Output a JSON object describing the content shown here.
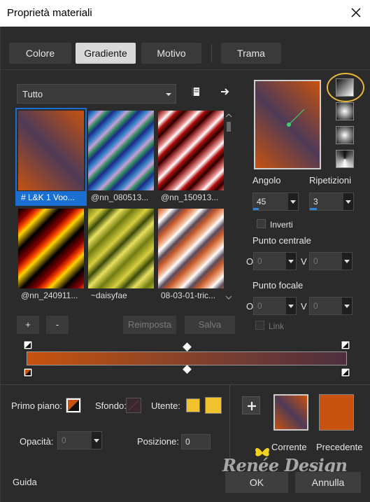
{
  "window": {
    "title": "Proprietà materiali"
  },
  "tabs": [
    {
      "label": "Colore"
    },
    {
      "label": "Gradiente"
    },
    {
      "label": "Motivo"
    },
    {
      "label": "Trama"
    }
  ],
  "gallery": {
    "filter": "Tutto",
    "items": [
      {
        "label": "# L&K 1 Voo..."
      },
      {
        "label": "@nn_080513..."
      },
      {
        "label": "@nn_150913..."
      },
      {
        "label": "@nn_240911..."
      },
      {
        "label": "~daisyfae"
      },
      {
        "label": "08-03-01-tric..."
      }
    ],
    "add_label": "+",
    "remove_label": "-",
    "reset_label": "Reimposta",
    "save_label": "Salva"
  },
  "settings": {
    "angle_label": "Angolo",
    "angle_value": "45",
    "repeats_label": "Ripetizioni",
    "repeats_value": "3",
    "invert_label": "Inverti",
    "center_label": "Punto centrale",
    "center_o_label": "O",
    "center_v_label": "V",
    "center_o_value": "0",
    "center_v_value": "0",
    "focal_label": "Punto focale",
    "focal_o_label": "O",
    "focal_v_label": "V",
    "focal_o_value": "0",
    "focal_v_value": "0",
    "link_label": "Link"
  },
  "bottom": {
    "foreground_label": "Primo piano:",
    "background_label": "Sfondo:",
    "user_label": "Utente:",
    "opacity_label": "Opacità:",
    "opacity_value": "0",
    "position_label": "Posizione:",
    "position_value": "0",
    "current_label": "Corrente",
    "previous_label": "Precedente",
    "guide_label": "Guida",
    "ok_label": "OK",
    "cancel_label": "Annulla",
    "watermark": "Renée Design"
  },
  "colors": {
    "accent": "#1a6fd1",
    "orange": "#c8520f",
    "purple": "#4e3a57",
    "yellow": "#f2c12e",
    "highlight_ring": "#e8b83a"
  }
}
